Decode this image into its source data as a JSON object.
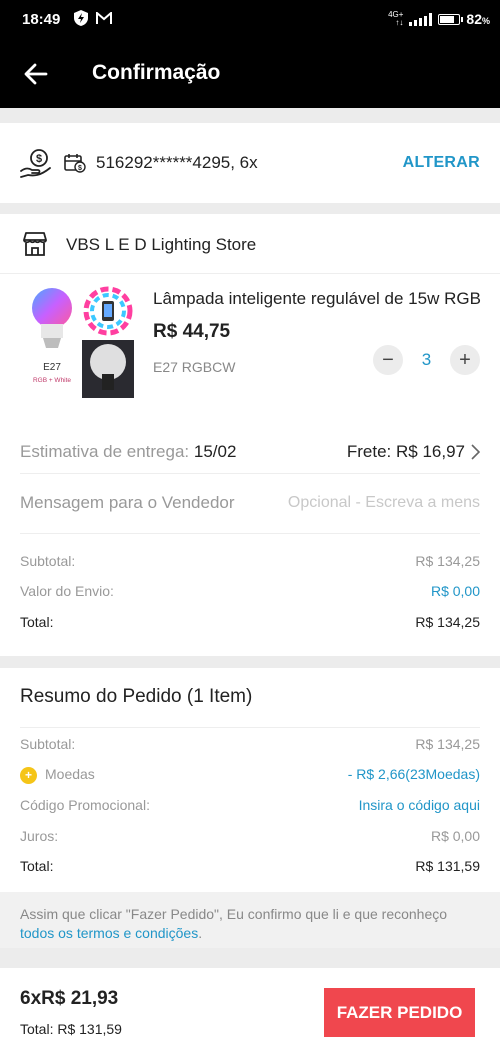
{
  "status_bar": {
    "time": "18:49",
    "network": "4G+",
    "battery_percent": "82",
    "battery_symbol": "%",
    "battery_level": 0.82
  },
  "header": {
    "title": "Confirmação"
  },
  "payment": {
    "card_text": "516292******4295, 6x",
    "change_label": "ALTERAR"
  },
  "store": {
    "name": "VBS L E D Lighting Store"
  },
  "product": {
    "title": "Lâmpada inteligente regulável de 15w RGB",
    "price": "R$ 44,75",
    "variant": "E27 RGBCW",
    "quantity": "3",
    "image_caption": "E27",
    "image_subcaption": "RGB + White"
  },
  "delivery": {
    "label": "Estimativa de entrega:",
    "date": "15/02",
    "shipping": "Frete: R$ 16,97"
  },
  "message": {
    "label": "Mensagem para o Vendedor",
    "placeholder": "Opcional - Escreva a mens"
  },
  "store_totals": {
    "subtotal_label": "Subtotal:",
    "subtotal": "R$ 134,25",
    "shipping_label": "Valor do Envio:",
    "shipping": "R$ 0,00",
    "total_label": "Total:",
    "total": "R$ 134,25"
  },
  "summary": {
    "heading": "Resumo do Pedido (1 Item)",
    "subtotal_label": "Subtotal:",
    "subtotal": "R$ 134,25",
    "coins_label": "Moedas",
    "coins": "- R$ 2,66(23Moedas)",
    "promo_label": "Código Promocional:",
    "promo_action": "Insira o código aqui",
    "interest_label": "Juros:",
    "interest": "R$ 0,00",
    "total_label": "Total:",
    "total": "R$ 131,59",
    "notice_text": "Assim que clicar \"Fazer Pedido\", Eu confirmo que li e que reconheço",
    "notice_link": "todos os termos e condições",
    "notice_end": "."
  },
  "footer": {
    "installments": "6xR$ 21,93",
    "total": "Total: R$ 131,59",
    "order_button": "FAZER PEDIDO"
  }
}
